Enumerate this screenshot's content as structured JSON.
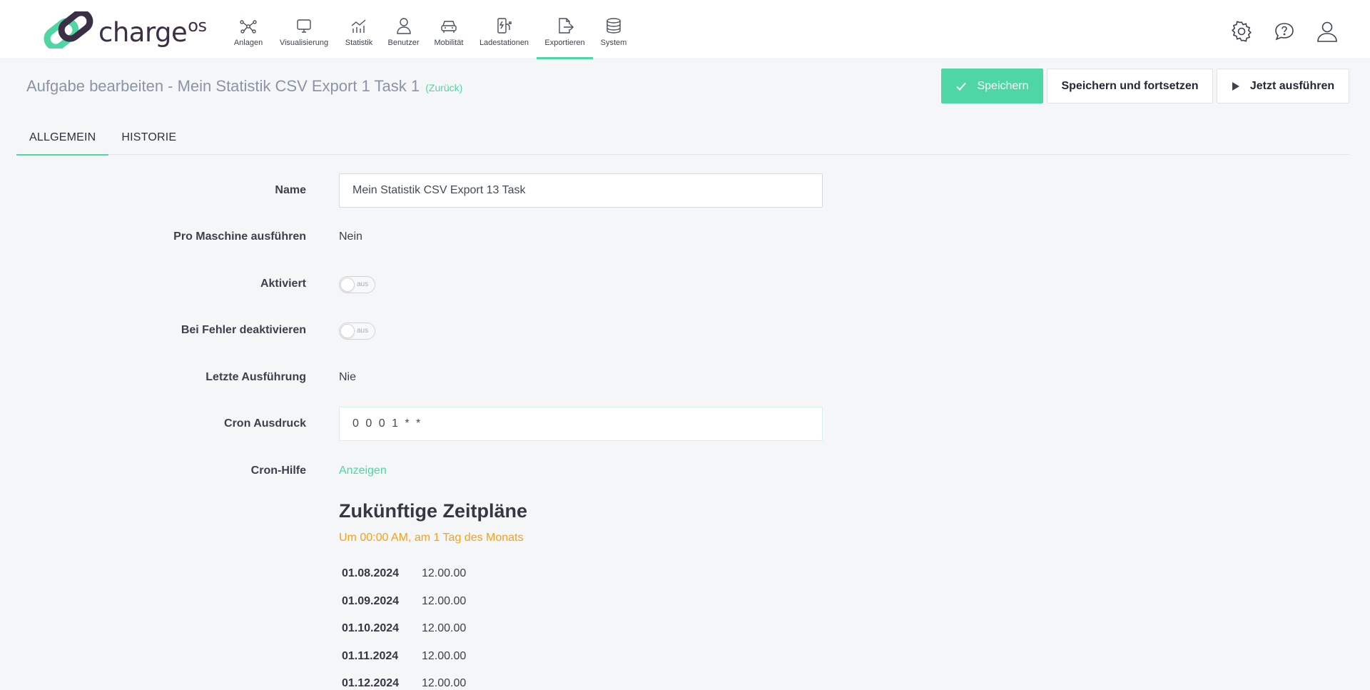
{
  "brand": {
    "name": "charge",
    "suffix": "OS",
    "color": "#4ed6a4",
    "dark": "#3b2f45"
  },
  "nav": [
    {
      "label": "Anlagen",
      "icon": "network-icon"
    },
    {
      "label": "Visualisierung",
      "icon": "monitor-icon"
    },
    {
      "label": "Statistik",
      "icon": "chart-icon"
    },
    {
      "label": "Benutzer",
      "icon": "user-icon"
    },
    {
      "label": "Mobilität",
      "icon": "car-icon"
    },
    {
      "label": "Ladestationen",
      "icon": "charging-station-icon"
    },
    {
      "label": "Exportieren",
      "icon": "export-icon",
      "active": true
    },
    {
      "label": "System",
      "icon": "database-icon"
    }
  ],
  "page": {
    "title": "Aufgabe bearbeiten - Mein Statistik CSV Export 1 Task 1",
    "back_label": "(Zurück)"
  },
  "actions": {
    "save": "Speichern",
    "save_continue": "Speichern und fortsetzen",
    "run_now": "Jetzt ausführen"
  },
  "tabs": [
    {
      "label": "ALLGEMEIN",
      "active": true
    },
    {
      "label": "HISTORIE",
      "active": false
    }
  ],
  "form": {
    "name_label": "Name",
    "name_value": "Mein Statistik CSV Export 13 Task",
    "per_machine_label": "Pro Maschine ausführen",
    "per_machine_value": "Nein",
    "active_label": "Aktiviert",
    "active_state": "aus",
    "disable_on_error_label": "Bei Fehler deaktivieren",
    "disable_on_error_state": "aus",
    "last_run_label": "Letzte Ausführung",
    "last_run_value": "Nie",
    "cron_label": "Cron Ausdruck",
    "cron_value": "0 0 0 1 * *",
    "cron_help_label": "Cron-Hilfe",
    "cron_help_link": "Anzeigen"
  },
  "schedule": {
    "title": "Zukünftige Zeitpläne",
    "description": "Um 00:00 AM, am 1 Tag des Monats",
    "rows": [
      {
        "date": "01.08.2024",
        "time": "12.00.00"
      },
      {
        "date": "01.09.2024",
        "time": "12.00.00"
      },
      {
        "date": "01.10.2024",
        "time": "12.00.00"
      },
      {
        "date": "01.11.2024",
        "time": "12.00.00"
      },
      {
        "date": "01.12.2024",
        "time": "12.00.00"
      }
    ]
  },
  "colors": {
    "accent": "#4ed6a4",
    "warning": "#f0a31b",
    "muted_title": "#8a94a6"
  }
}
